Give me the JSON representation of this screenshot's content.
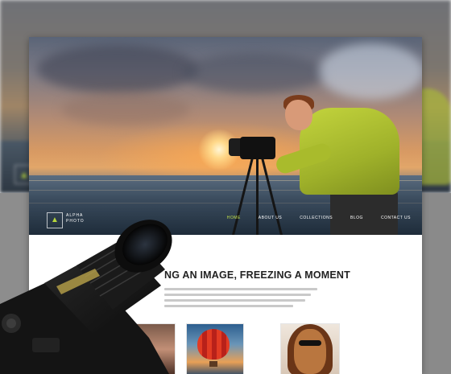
{
  "site": {
    "brand_line1": "ALPHA",
    "brand_line2": "PHOTO",
    "logo_glyph": "▲"
  },
  "nav": {
    "items": [
      {
        "label": "HOME",
        "active": true
      },
      {
        "label": "ABOUT US",
        "active": false
      },
      {
        "label": "COLLECTIONS",
        "active": false
      },
      {
        "label": "BLOG",
        "active": false
      },
      {
        "label": "CONTACT US",
        "active": false
      }
    ]
  },
  "intro": {
    "headline": "NG AN IMAGE, FREEZING A MOMENT"
  },
  "colors": {
    "accent": "#b6d63c",
    "page_bg": "#ffffff"
  }
}
